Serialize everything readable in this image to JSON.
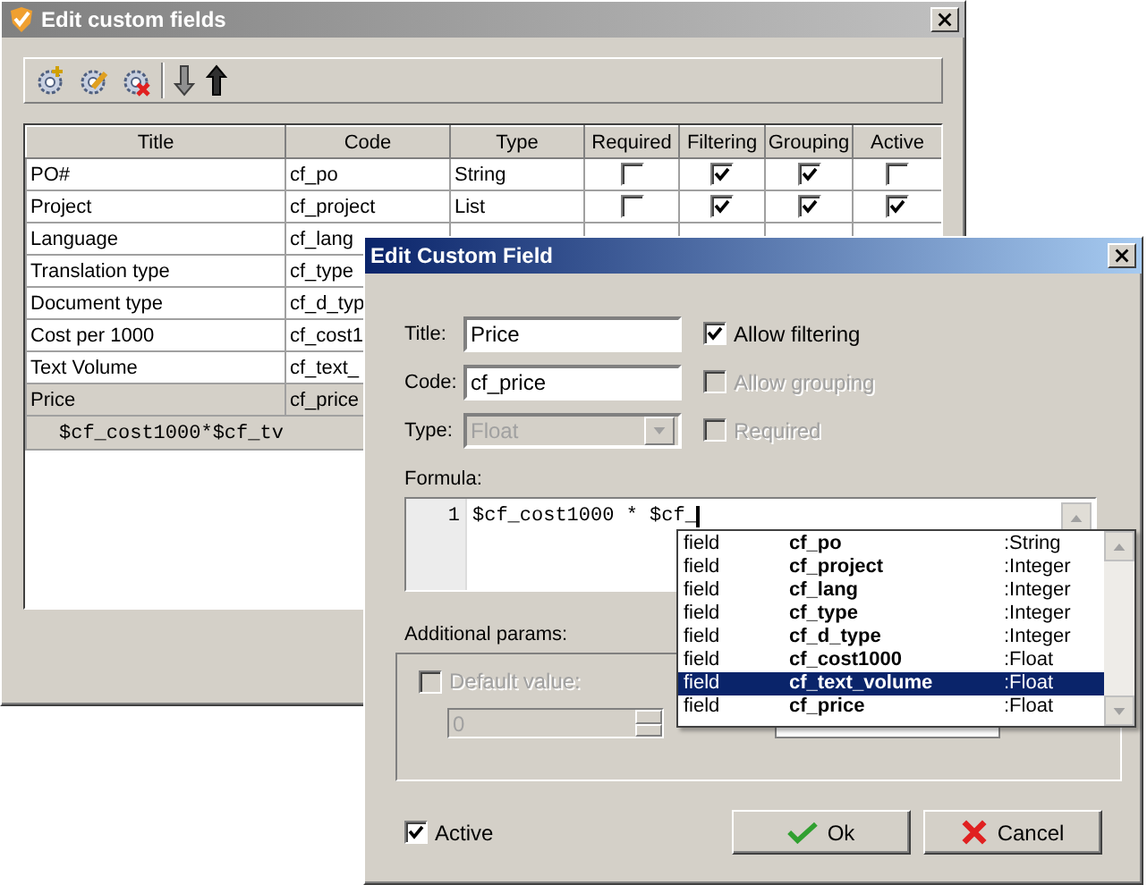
{
  "back_window": {
    "title": "Edit custom fields",
    "toolbar": [
      {
        "kind": "add"
      },
      {
        "kind": "edit"
      },
      {
        "kind": "delete"
      },
      {
        "kind": "down"
      },
      {
        "kind": "up"
      }
    ],
    "table": {
      "columns": [
        "Title",
        "Code",
        "Type",
        "Required",
        "Filtering",
        "Grouping",
        "Active"
      ],
      "rows": [
        {
          "title": "PO#",
          "code": "cf_po",
          "type": "String",
          "required": false,
          "filtering": true,
          "grouping": true,
          "active": false,
          "selected": false
        },
        {
          "title": "Project",
          "code": "cf_project",
          "type": "List",
          "required": false,
          "filtering": true,
          "grouping": true,
          "active": true,
          "selected": false
        },
        {
          "title": "Language",
          "code": "cf_lang",
          "selected": false
        },
        {
          "title": "Translation type",
          "code": "cf_type",
          "selected": false
        },
        {
          "title": "Document type",
          "code": "cf_d_typ",
          "selected": false
        },
        {
          "title": "Cost per 1000",
          "code": "cf_cost1",
          "selected": false
        },
        {
          "title": "Text Volume",
          "code": "cf_text_",
          "selected": false
        },
        {
          "title": "Price",
          "code": "cf_price",
          "selected": true,
          "formula": "$cf_cost1000*$cf_tv"
        }
      ]
    }
  },
  "dialog": {
    "title": "Edit Custom Field",
    "fields": [
      {
        "kind": "text",
        "label": "Title:",
        "value": "Price",
        "disabled": false
      },
      {
        "kind": "text",
        "label": "Code:",
        "value": "cf_price",
        "disabled": false
      },
      {
        "kind": "select",
        "label": "Type:",
        "value": "Float",
        "disabled": true
      }
    ],
    "options": [
      {
        "label": "Allow filtering",
        "checked": true,
        "disabled": false
      },
      {
        "label": "Allow grouping",
        "checked": false,
        "disabled": true
      },
      {
        "label": "Required",
        "checked": false,
        "disabled": true
      }
    ],
    "formula_label": "Formula:",
    "editor": {
      "line_number": "1",
      "text": "$cf_cost1000 * $cf_"
    },
    "completion": [
      {
        "category": "field",
        "name": "cf_po",
        "type": ":String",
        "selected": false
      },
      {
        "category": "field",
        "name": "cf_project",
        "type": ":Integer",
        "selected": false
      },
      {
        "category": "field",
        "name": "cf_lang",
        "type": ":Integer",
        "selected": false
      },
      {
        "category": "field",
        "name": "cf_type",
        "type": ":Integer",
        "selected": false
      },
      {
        "category": "field",
        "name": "cf_d_type",
        "type": ":Integer",
        "selected": false
      },
      {
        "category": "field",
        "name": "cf_cost1000",
        "type": ":Float",
        "selected": false
      },
      {
        "category": "field",
        "name": "cf_text_volume",
        "type": ":Float",
        "selected": true
      },
      {
        "category": "field",
        "name": "cf_price",
        "type": ":Float",
        "selected": false
      }
    ],
    "additional_params_label": "Additional params:",
    "default_value": {
      "label": "Default value:",
      "checked": false,
      "disabled": true,
      "value": "0"
    },
    "active": {
      "label": "Active",
      "checked": true
    },
    "buttons": [
      {
        "kind": "ok",
        "label": "Ok"
      },
      {
        "kind": "cancel",
        "label": "Cancel"
      }
    ]
  }
}
